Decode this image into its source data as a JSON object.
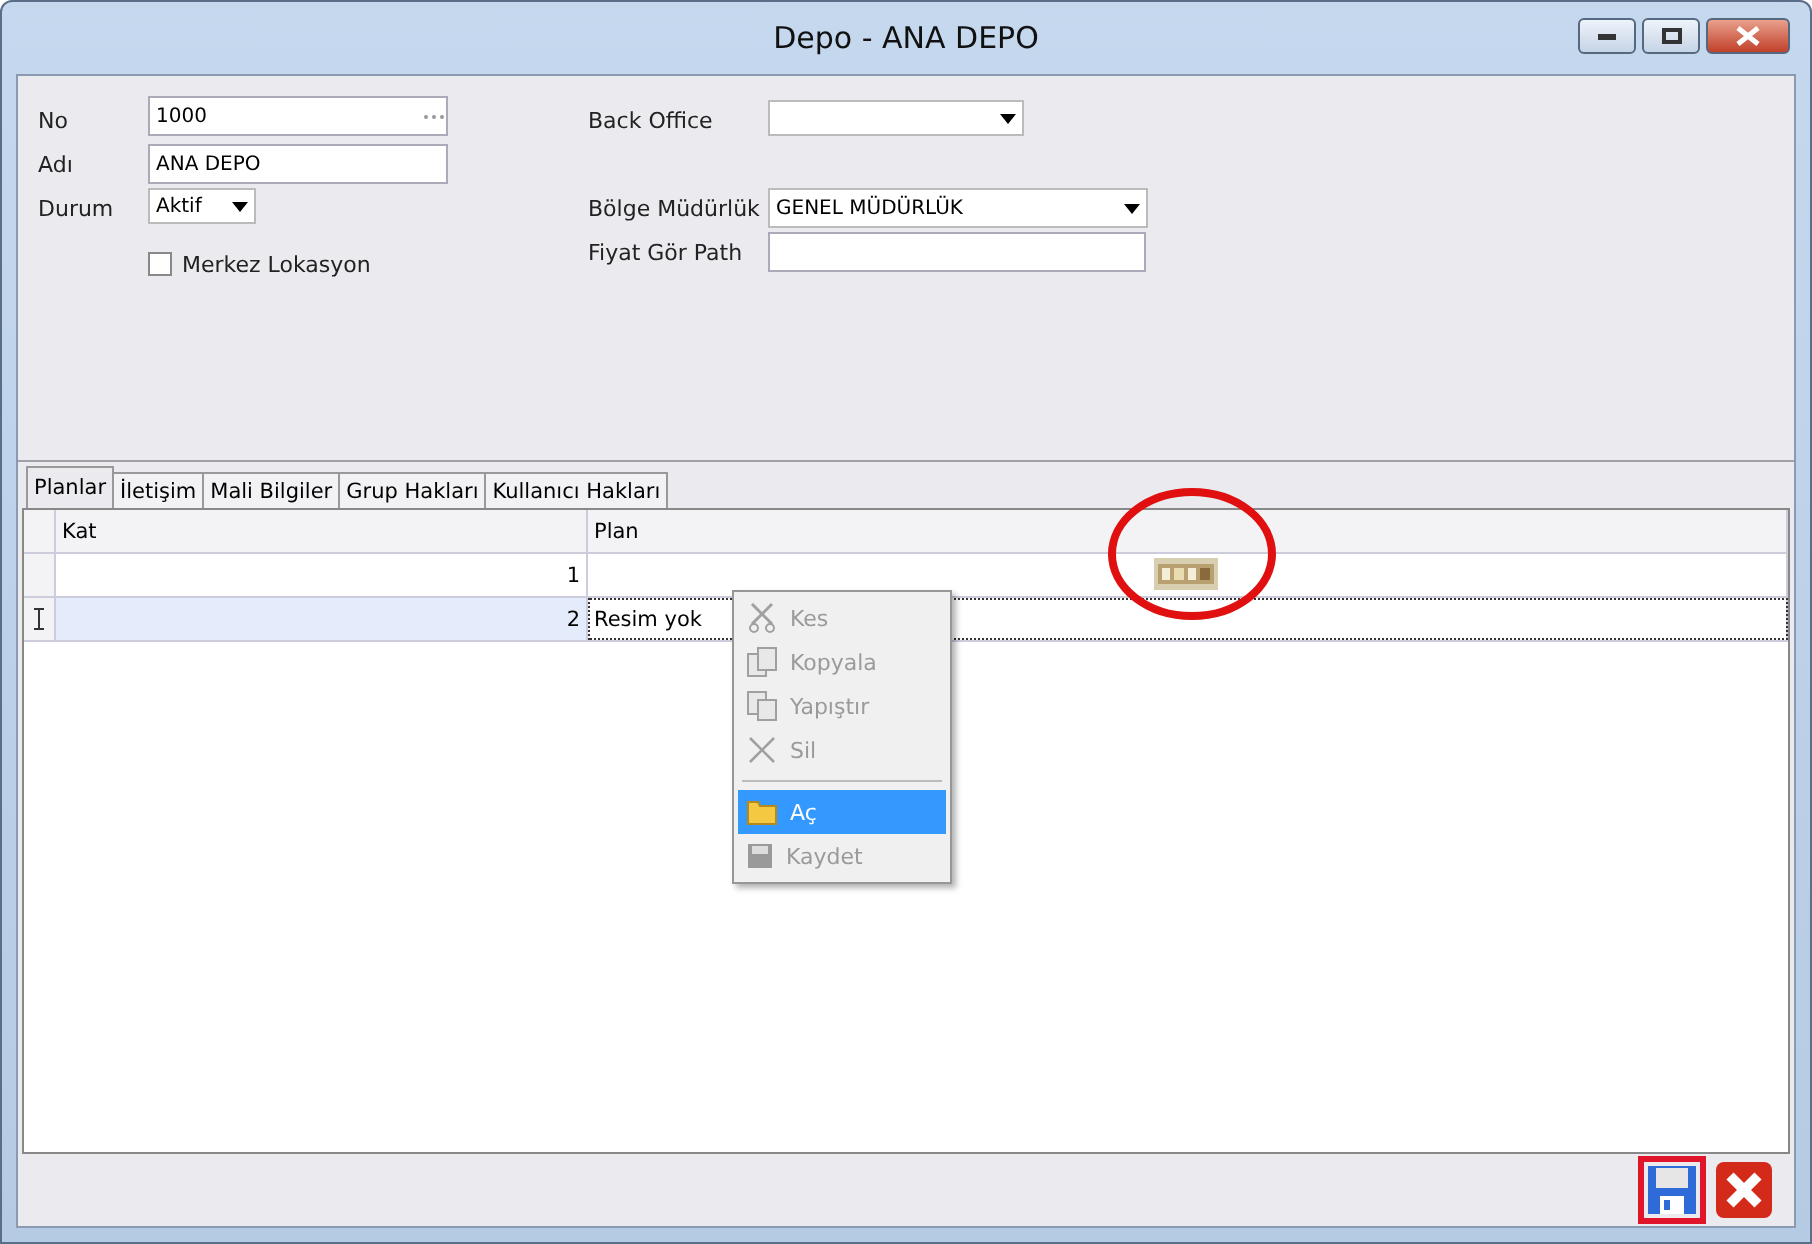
{
  "window": {
    "title": "Depo - ANA DEPO"
  },
  "form": {
    "no_label": "No",
    "no_value": "1000",
    "name_label": "Adı",
    "name_value": "ANA DEPO",
    "status_label": "Durum",
    "status_value": "Aktif",
    "main_location": {
      "label": "Merkez Lokasyon",
      "checked": false
    },
    "back_office_label": "Back Office",
    "region_label": "Bölge Müdürlük",
    "region_value": "GENEL MÜDÜRLÜK",
    "price_path_label": "Fiyat Gör Path"
  },
  "tabs": [
    {
      "label": "Planlar",
      "selected": true
    },
    {
      "label": "İletişim",
      "selected": false
    },
    {
      "label": "Mali Bilgiler",
      "selected": false
    },
    {
      "label": "Grup Hakları",
      "selected": false
    },
    {
      "label": "Kullanıcı Hakları",
      "selected": false
    }
  ],
  "table": {
    "columns": [
      "Kat",
      "Plan"
    ],
    "rows": [
      {
        "kat": "1",
        "plan": "",
        "has_image": true,
        "selected": false
      },
      {
        "kat": "2",
        "plan": "Resim yok",
        "has_image": false,
        "selected": true
      }
    ]
  },
  "context_menu": [
    {
      "kind": "cut",
      "label": "Kes",
      "disabled": true,
      "selected": false
    },
    {
      "kind": "copy",
      "label": "Kopyala",
      "disabled": true,
      "selected": false
    },
    {
      "kind": "paste",
      "label": "Yapıştır",
      "disabled": true,
      "selected": false
    },
    {
      "kind": "delete",
      "label": "Sil",
      "disabled": true,
      "selected": false
    },
    {
      "kind": "separator"
    },
    {
      "kind": "open",
      "label": "Aç",
      "disabled": false,
      "selected": true
    },
    {
      "kind": "save",
      "label": "Kaydet",
      "disabled": true,
      "selected": false
    }
  ]
}
